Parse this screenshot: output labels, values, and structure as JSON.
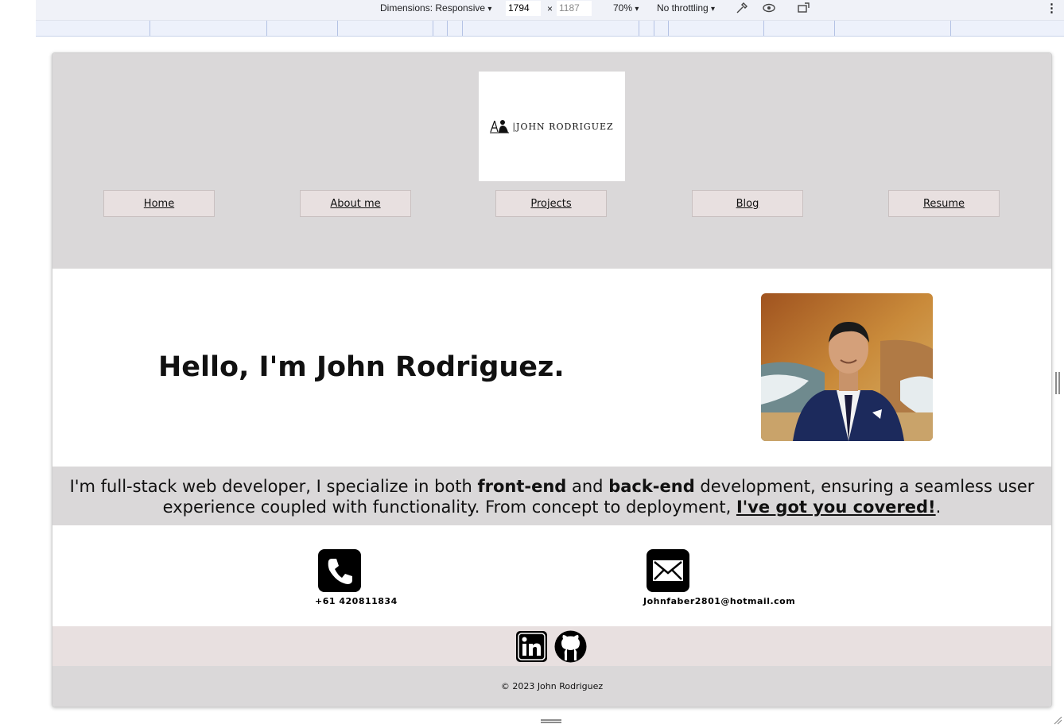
{
  "devtools": {
    "dimensions_label": "Dimensions: Responsive",
    "width_value": "1794",
    "times": "×",
    "height_value": "1187",
    "zoom": "70%",
    "throttling": "No throttling",
    "caret": "▾",
    "more": "⋮"
  },
  "site": {
    "logo_text": "|JOHN RODRIGUEZ",
    "nav": [
      {
        "label": "Home"
      },
      {
        "label": "About me"
      },
      {
        "label": "Projects"
      },
      {
        "label": "Blog"
      },
      {
        "label": "Resume"
      }
    ],
    "hero_title": "Hello, I'm John Rodriguez.",
    "about": {
      "part1": "I'm full-stack web developer, I specialize in both ",
      "bold1": "front-end",
      "part2": " and ",
      "bold2": "back-end",
      "part3": " development, ensuring a seamless user experience coupled with functionality. From concept to deployment, ",
      "link": "I've got you covered!",
      "part4": "."
    },
    "contact": {
      "phone": "+61 420811834",
      "email": "Johnfaber2801@hotmail.com"
    },
    "social_icons": [
      "linkedin-icon",
      "github-icon"
    ],
    "footer": "© 2023 John Rodriguez"
  }
}
